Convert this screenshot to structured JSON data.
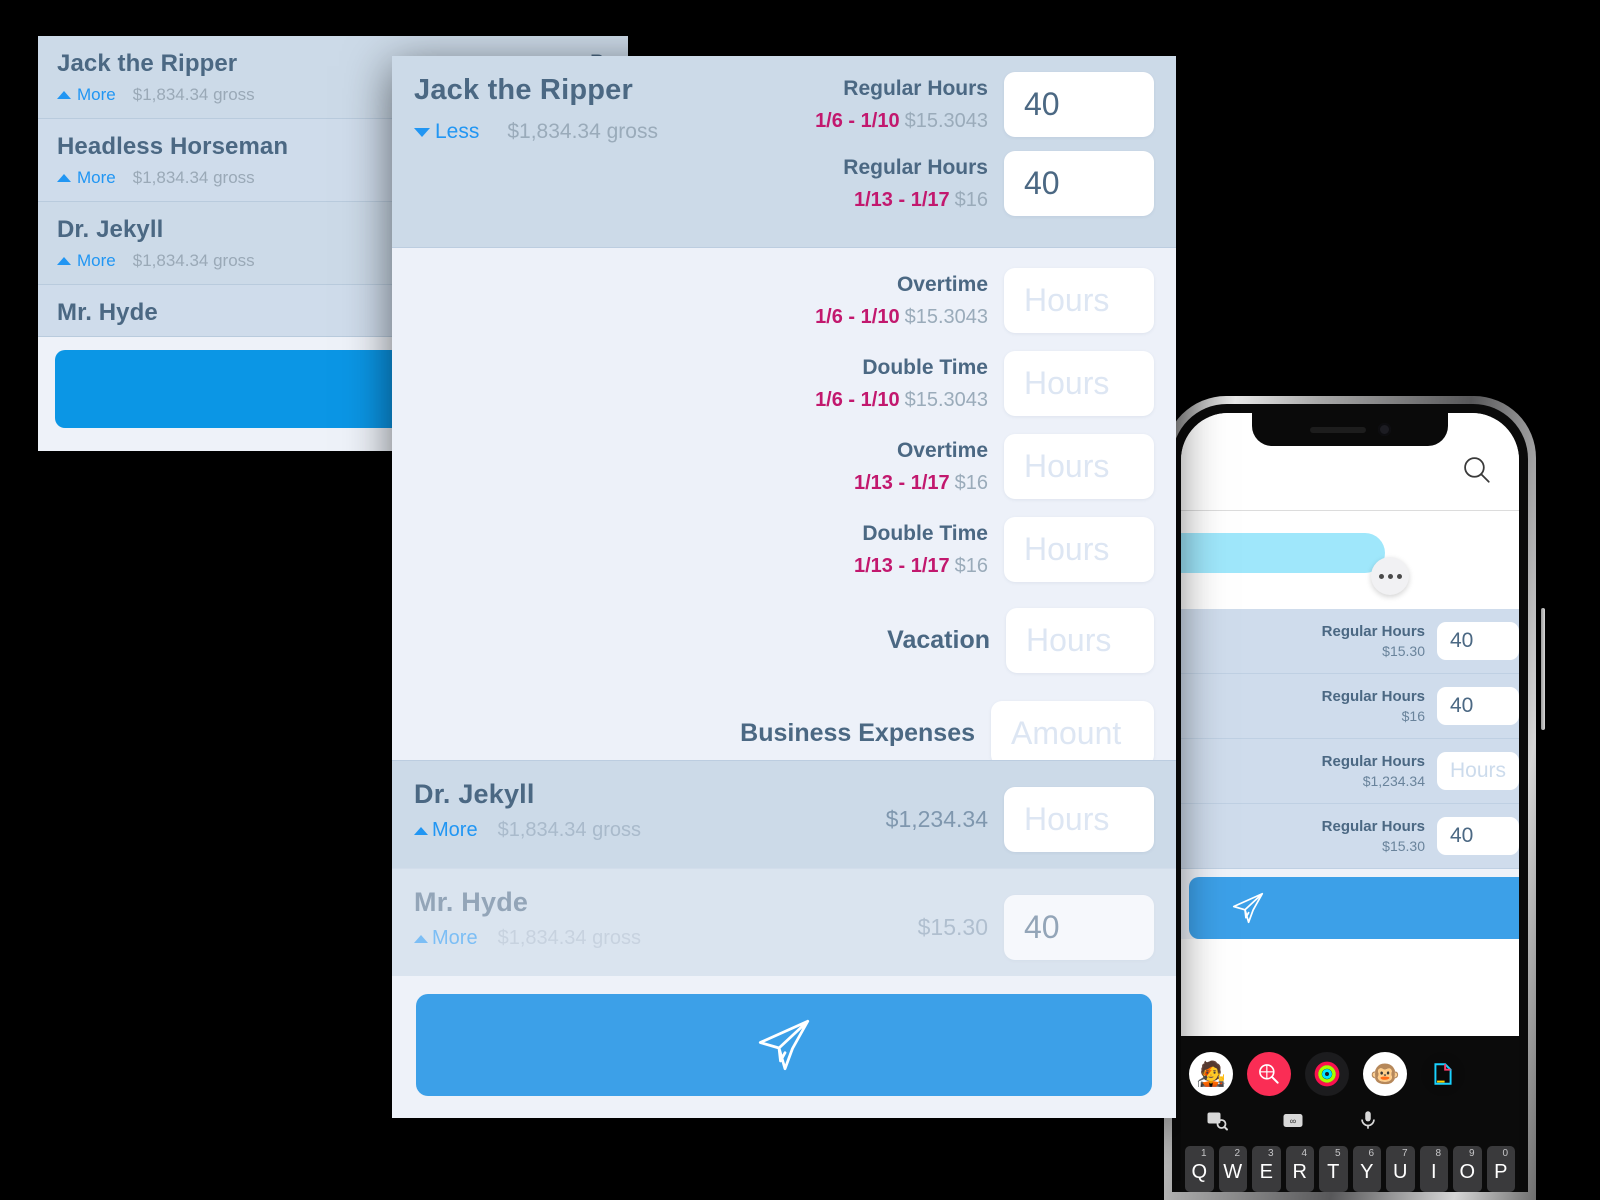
{
  "background_list": {
    "rows": [
      {
        "name": "Jack the Ripper",
        "more_label": "More",
        "gross": "$1,834.34 gross",
        "right_label": "R"
      },
      {
        "name": "Headless Horseman",
        "more_label": "More",
        "gross": "$1,834.34 gross",
        "right_label": ""
      },
      {
        "name": "Dr. Jekyll",
        "more_label": "More",
        "gross": "$1,834.34 gross",
        "right_label": ""
      },
      {
        "name": "Mr. Hyde",
        "more_label": "",
        "gross": "",
        "right_label": ""
      }
    ],
    "send_icon": "paper-plane-icon",
    "send_color": "#0b96e5"
  },
  "main_panel": {
    "header": {
      "employee_name": "Jack the Ripper",
      "toggle_label": "Less",
      "toggle_icon": "triangle-down-icon",
      "gross": "$1,834.34 gross",
      "ghost_text": "",
      "earnings": [
        {
          "type": "Regular Hours",
          "date_range": "1/6 - 1/10",
          "rate": "$15.3043",
          "value": "40",
          "placeholder": "Hours"
        },
        {
          "type": "Regular Hours",
          "date_range": "1/13 - 1/17",
          "rate": "$16",
          "value": "40",
          "placeholder": "Hours"
        }
      ]
    },
    "body_rows": [
      {
        "type": "Overtime",
        "date_range": "1/6 - 1/10",
        "rate": "$15.3043",
        "value": "",
        "placeholder": "Hours"
      },
      {
        "type": "Double Time",
        "date_range": "1/6 - 1/10",
        "rate": "$15.3043",
        "value": "",
        "placeholder": "Hours"
      },
      {
        "type": "Overtime",
        "date_range": "1/13 - 1/17",
        "rate": "$16",
        "value": "",
        "placeholder": "Hours"
      },
      {
        "type": "Double Time",
        "date_range": "1/13 - 1/17",
        "rate": "$16",
        "value": "",
        "placeholder": "Hours"
      }
    ],
    "simple_rows": [
      {
        "type": "Vacation",
        "value": "",
        "placeholder": "Hours"
      },
      {
        "type": "Business Expenses",
        "value": "",
        "placeholder": "Amount"
      }
    ],
    "footer_rows": [
      {
        "name": "Dr. Jekyll",
        "more_label": "More",
        "gross": "$1,834.34 gross",
        "amount": "$1,234.34",
        "value": "",
        "placeholder": "Hours"
      },
      {
        "name": "Mr. Hyde",
        "more_label": "More",
        "gross": "$1,834.34 gross",
        "amount": "$15.30",
        "value": "40",
        "placeholder": "Hours"
      }
    ],
    "send_icon": "paper-plane-icon",
    "send_color": "#3ca0e8",
    "accent_link_color": "#2196f3",
    "date_color": "#c2186e"
  },
  "phone": {
    "status_icons": {
      "speaker": "speaker-grille-icon",
      "camera": "front-camera-icon"
    },
    "nav": {
      "search_icon": "search-icon"
    },
    "message": {
      "bubble_color": "#9fe7fb",
      "more_icon": "ellipsis-icon"
    },
    "rows": [
      {
        "type": "Regular Hours",
        "rate": "$15.30",
        "value": "40",
        "placeholder": "Hours"
      },
      {
        "type": "Regular Hours",
        "rate": "$16",
        "value": "40",
        "placeholder": "Hours"
      },
      {
        "type": "Regular Hours",
        "rate": "$1,234.34",
        "value": "",
        "placeholder": "Hours"
      },
      {
        "type": "Regular Hours",
        "rate": "$15.30",
        "value": "40",
        "placeholder": "Hours"
      }
    ],
    "send_icon": "paper-plane-icon",
    "keyboard": {
      "app_icons": [
        "memoji-avatar-icon",
        "image-search-icon",
        "activity-rings-icon",
        "monkey-memoji-icon",
        "markup-app-icon"
      ],
      "tool_icons": [
        "photo-search-icon",
        "camera-infinity-icon",
        "microphone-icon"
      ],
      "keys": [
        {
          "letter": "Q",
          "num": "1"
        },
        {
          "letter": "W",
          "num": "2"
        },
        {
          "letter": "E",
          "num": "3"
        },
        {
          "letter": "R",
          "num": "4"
        },
        {
          "letter": "T",
          "num": "5"
        },
        {
          "letter": "Y",
          "num": "6"
        },
        {
          "letter": "U",
          "num": "7"
        },
        {
          "letter": "I",
          "num": "8"
        },
        {
          "letter": "O",
          "num": "9"
        },
        {
          "letter": "P",
          "num": "0"
        }
      ]
    }
  }
}
